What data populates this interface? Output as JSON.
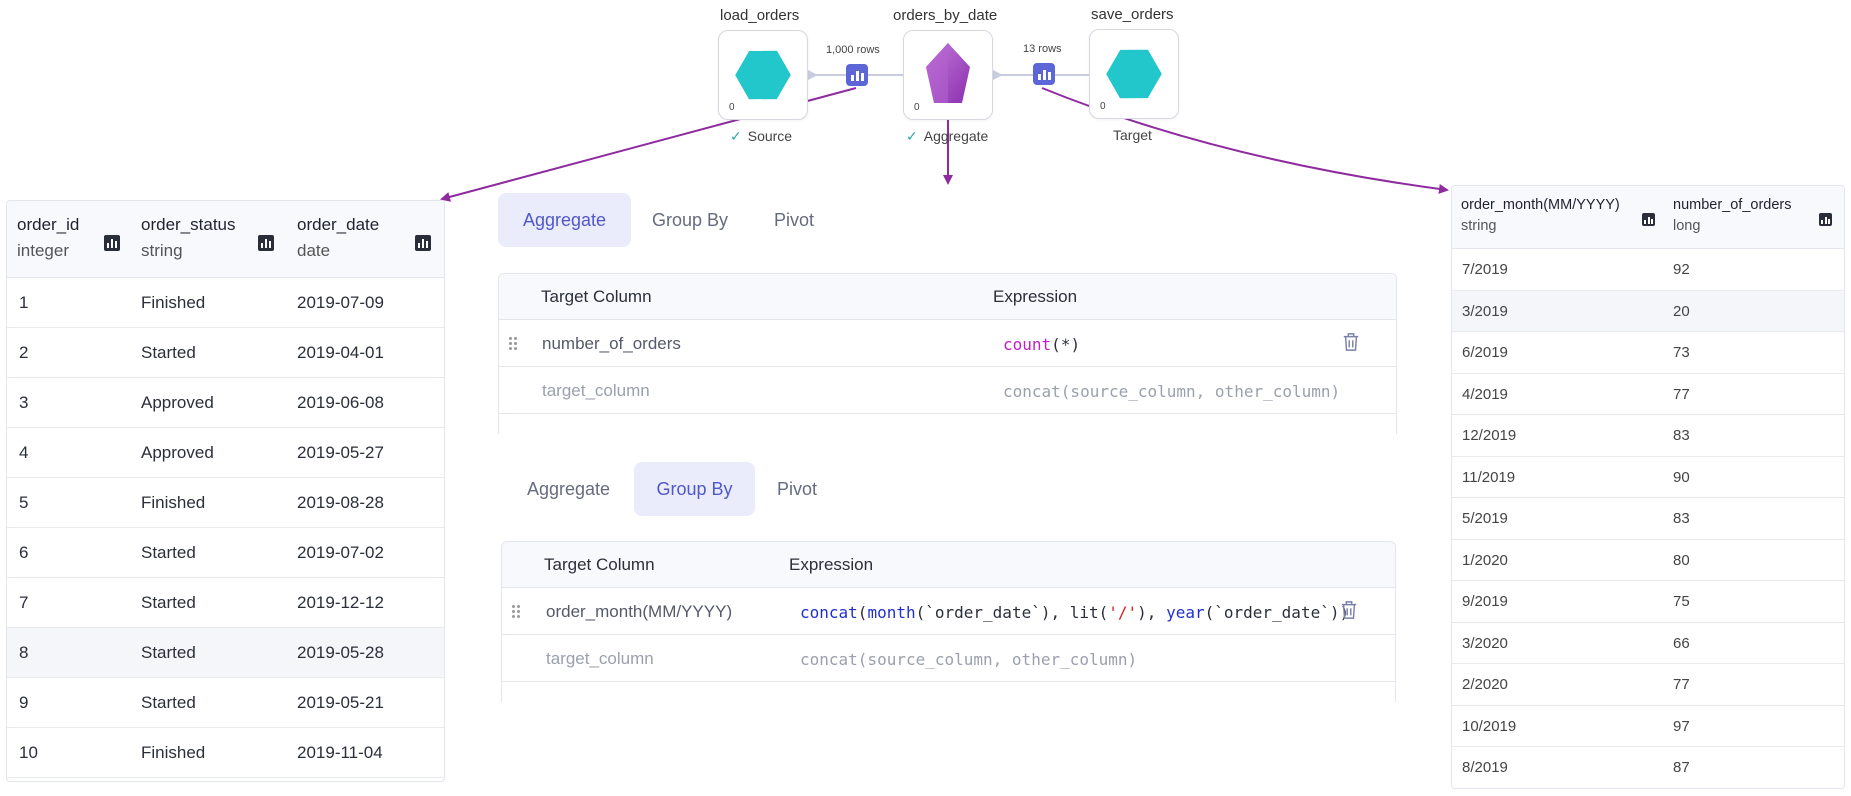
{
  "pipeline": {
    "nodes": [
      {
        "name": "load_orders",
        "count": "0",
        "status": "Source",
        "checked": true,
        "shape": "hexagon",
        "color": "#22c7cc"
      },
      {
        "name": "orders_by_date",
        "count": "0",
        "status": "Aggregate",
        "checked": true,
        "shape": "pentagon",
        "color": "#9b40c0"
      },
      {
        "name": "save_orders",
        "count": "0",
        "status": "Target",
        "checked": false,
        "shape": "hexagon",
        "color": "#22c7cc"
      }
    ],
    "connections": [
      {
        "rows_label": "1,000 rows"
      },
      {
        "rows_label": "13 rows"
      }
    ],
    "arrow_color": "#8e2b9e",
    "accent_color": "#5d66d6"
  },
  "source_table": {
    "columns": [
      {
        "name": "order_id",
        "type": "integer"
      },
      {
        "name": "order_status",
        "type": "string"
      },
      {
        "name": "order_date",
        "type": "date"
      }
    ],
    "rows": [
      [
        "1",
        "Finished",
        "2019-07-09"
      ],
      [
        "2",
        "Started",
        "2019-04-01"
      ],
      [
        "3",
        "Approved",
        "2019-06-08"
      ],
      [
        "4",
        "Approved",
        "2019-05-27"
      ],
      [
        "5",
        "Finished",
        "2019-08-28"
      ],
      [
        "6",
        "Started",
        "2019-07-02"
      ],
      [
        "7",
        "Started",
        "2019-12-12"
      ],
      [
        "8",
        "Started",
        "2019-05-28"
      ],
      [
        "9",
        "Started",
        "2019-05-21"
      ],
      [
        "10",
        "Finished",
        "2019-11-04"
      ]
    ]
  },
  "aggregate_panel": {
    "tabs": [
      "Aggregate",
      "Group By",
      "Pivot"
    ],
    "active_tab": "Aggregate",
    "header": {
      "target": "Target Column",
      "expression": "Expression"
    },
    "row": {
      "target": "number_of_orders",
      "fn": "count",
      "open": "(",
      "arg": "*",
      "close": ")"
    },
    "placeholder": {
      "target": "target_column",
      "expression": "concat(source_column, other_column)"
    }
  },
  "groupby_panel": {
    "tabs": [
      "Aggregate",
      "Group By",
      "Pivot"
    ],
    "active_tab": "Group By",
    "header": {
      "target": "Target Column",
      "expression": "Expression"
    },
    "row": {
      "target": "order_month(MM/YYYY)",
      "concat": "concat",
      "open1": "(",
      "month": "month",
      "arg1": "(`order_date`), lit(",
      "str": "'/'",
      "mid": "), ",
      "year": "year",
      "arg2": "(`order_date`))"
    },
    "placeholder": {
      "target": "target_column",
      "expression": "concat(source_column, other_column)"
    }
  },
  "result_table": {
    "columns": [
      {
        "name": "order_month(MM/YYYY)",
        "type": "string"
      },
      {
        "name": "number_of_orders",
        "type": "long"
      }
    ],
    "rows": [
      [
        "7/2019",
        "92"
      ],
      [
        "3/2019",
        "20"
      ],
      [
        "6/2019",
        "73"
      ],
      [
        "4/2019",
        "77"
      ],
      [
        "12/2019",
        "83"
      ],
      [
        "11/2019",
        "90"
      ],
      [
        "5/2019",
        "83"
      ],
      [
        "1/2020",
        "80"
      ],
      [
        "9/2019",
        "75"
      ],
      [
        "3/2020",
        "66"
      ],
      [
        "2/2020",
        "77"
      ],
      [
        "10/2019",
        "97"
      ],
      [
        "8/2019",
        "87"
      ]
    ]
  }
}
